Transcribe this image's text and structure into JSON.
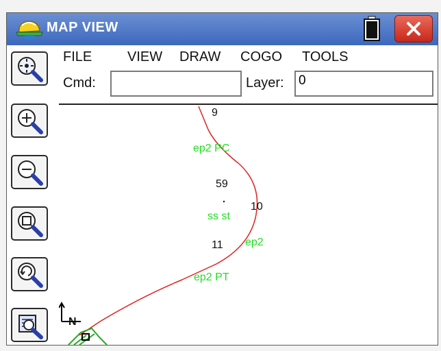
{
  "window": {
    "title": "MAP VIEW",
    "accent_color": "#3d68bd",
    "close_icon": "close-icon",
    "battery_icon": "battery-icon",
    "logo_icon": "surveyor-helmet-icon"
  },
  "menu": {
    "items": [
      "FILE",
      "VIEW",
      "DRAW",
      "COGO",
      "TOOLS"
    ]
  },
  "command": {
    "cmd_label": "Cmd:",
    "cmd_value": "",
    "layer_label": "Layer:",
    "layer_value": "0"
  },
  "tools": [
    {
      "name": "zoom-extents-icon"
    },
    {
      "name": "zoom-in-icon"
    },
    {
      "name": "zoom-out-icon"
    },
    {
      "name": "zoom-window-icon"
    },
    {
      "name": "zoom-previous-icon"
    },
    {
      "name": "screen-options-icon"
    }
  ],
  "map": {
    "line_color": "#e02020",
    "point_label_color": "#22dd22",
    "north_label": "N",
    "points": {
      "p9": "9",
      "p59": "59",
      "p10": "10",
      "p11": "11",
      "ep2pc": "ep2 PC",
      "ssst": "ss st",
      "ep2": "ep2",
      "ep2pt": "ep2 PT"
    }
  }
}
